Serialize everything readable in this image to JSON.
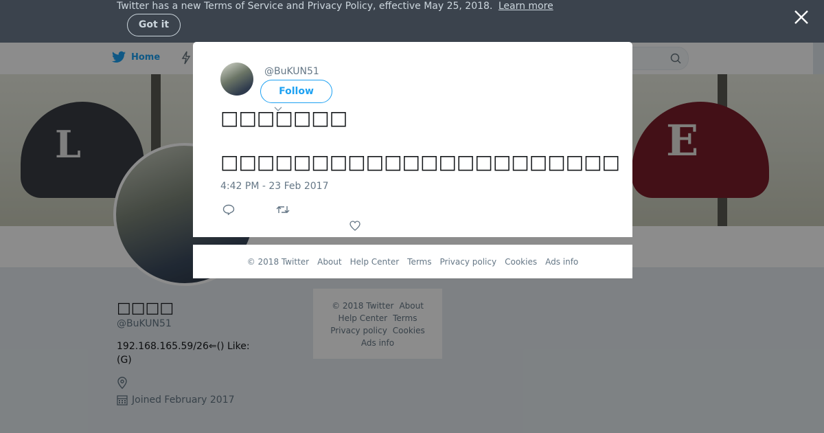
{
  "tos_banner": {
    "text": "Twitter has a new Terms of Service and Privacy Policy, effective May 25, 2018.",
    "link": "Learn more",
    "button": "Got it"
  },
  "nav": {
    "home": "Home"
  },
  "banner": {
    "left_logo": "L",
    "right_logo": "E"
  },
  "profile": {
    "name": "□□□□",
    "handle": "@BuKUN51",
    "bio": "192.168.165.59/26⇐() Like:\n (G)",
    "joined": "Joined February 2017"
  },
  "side_footer": {
    "links": [
      "© 2018 Twitter",
      "About",
      "Help Center",
      "Terms",
      "Privacy policy",
      "Cookies",
      "Ads info"
    ]
  },
  "tweet": {
    "handle": "@BuKUN51",
    "follow": "Follow",
    "line1": "□□□□□□□",
    "line2": "□□□□□□□□□□□□□□□□□□□□□□□□□□□□□□□",
    "time": "4:42 PM - 23 Feb 2017"
  },
  "modal_footer": {
    "links": [
      "© 2018 Twitter",
      "About",
      "Help Center",
      "Terms",
      "Privacy policy",
      "Cookies",
      "Ads info"
    ]
  },
  "icons": {
    "brand": "twitter-bird-icon",
    "close": "close-icon",
    "search": "search-icon",
    "reply": "reply-icon",
    "retweet": "retweet-icon",
    "like": "heart-icon",
    "location": "location-icon",
    "calendar": "calendar-icon"
  },
  "colors": {
    "accent": "#1da1f2",
    "tos_banner_bg": "#3b434d",
    "page_bg": "#e6ecf0"
  }
}
